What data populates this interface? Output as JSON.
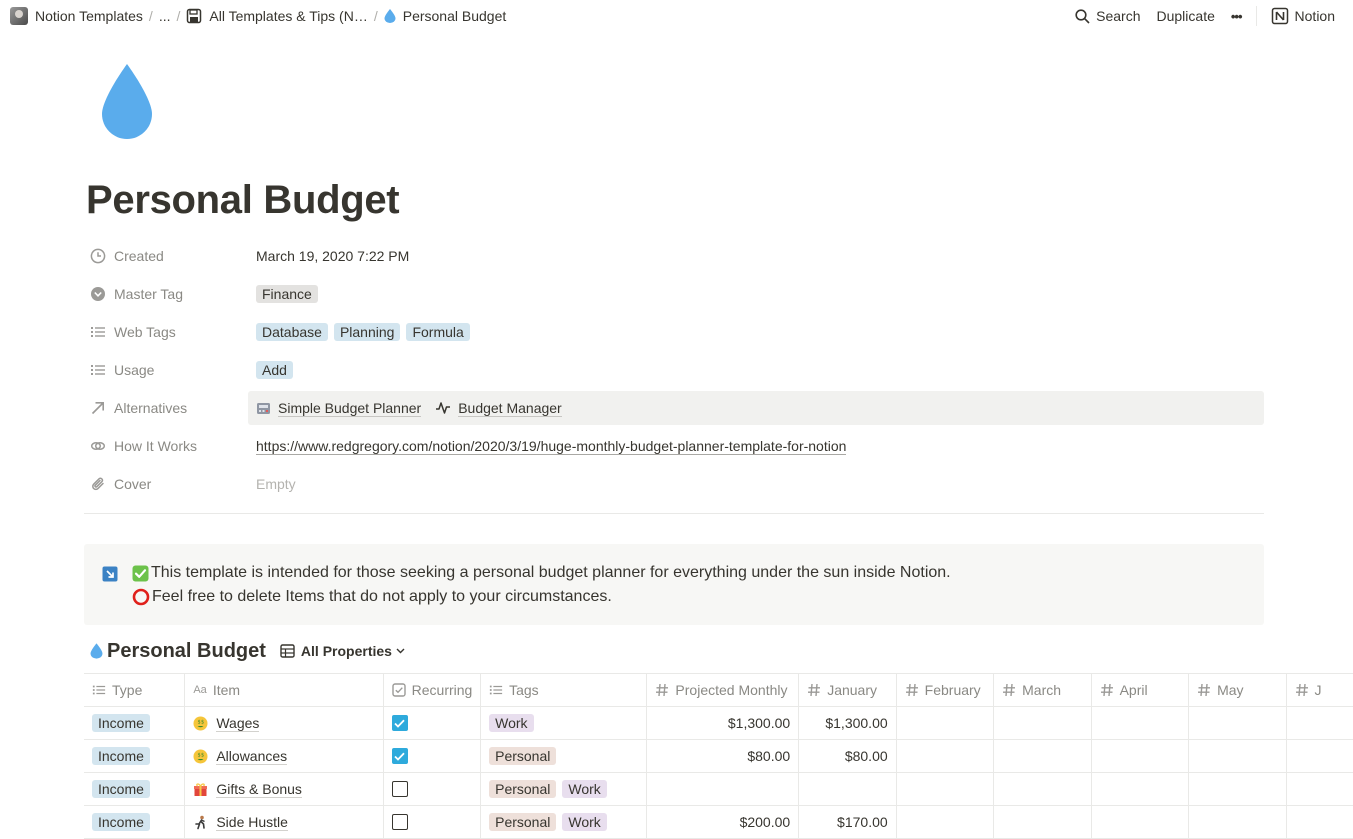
{
  "breadcrumb": {
    "workspace": "Notion Templates",
    "ellipsis": "...",
    "section": "All Templates & Tips (N…",
    "current": "Personal Budget",
    "separator": "/"
  },
  "top_actions": {
    "search": "Search",
    "duplicate": "Duplicate",
    "more": "•••",
    "notion": "Notion"
  },
  "page": {
    "title": "Personal Budget",
    "icon": "droplet-icon"
  },
  "properties": {
    "created": {
      "label": "Created",
      "value": "March 19, 2020 7:22 PM"
    },
    "master_tag": {
      "label": "Master Tag",
      "tags": [
        "Finance"
      ]
    },
    "web_tags": {
      "label": "Web Tags",
      "tags": [
        "Database",
        "Planning",
        "Formula"
      ]
    },
    "usage": {
      "label": "Usage",
      "tags": [
        "Add"
      ]
    },
    "alternatives": {
      "label": "Alternatives",
      "items": [
        "Simple Budget Planner",
        "Budget Manager"
      ]
    },
    "how_it_works": {
      "label": "How It Works",
      "value": "https://www.redgregory.com/notion/2020/3/19/huge-monthly-budget-planner-template-for-notion"
    },
    "cover": {
      "label": "Cover",
      "value": "Empty"
    }
  },
  "callout": {
    "line1": "This template is intended for those seeking a personal budget planner for everything under the sun inside Notion.",
    "line2": "Feel free to delete Items that do not apply to your circumstances."
  },
  "database": {
    "title": "Personal Budget",
    "view": "All Properties",
    "columns": [
      "Type",
      "Item",
      "Recurring",
      "Tags",
      "Projected Monthly",
      "January",
      "February",
      "March",
      "April",
      "May",
      "J"
    ],
    "rows": [
      {
        "type": "Income",
        "item": "Wages",
        "icon": "money-face-icon",
        "recurring": true,
        "tags": [
          "Work"
        ],
        "projected": "$1,300.00",
        "january": "$1,300.00"
      },
      {
        "type": "Income",
        "item": "Allowances",
        "icon": "money-face-icon",
        "recurring": true,
        "tags": [
          "Personal"
        ],
        "projected": "$80.00",
        "january": "$80.00"
      },
      {
        "type": "Income",
        "item": "Gifts & Bonus",
        "icon": "gift-icon",
        "recurring": false,
        "tags": [
          "Personal",
          "Work"
        ],
        "projected": "",
        "january": ""
      },
      {
        "type": "Income",
        "item": "Side Hustle",
        "icon": "person-running-icon",
        "recurring": false,
        "tags": [
          "Personal",
          "Work"
        ],
        "projected": "$200.00",
        "january": "$170.00"
      }
    ]
  },
  "colors": {
    "text": "#37352f",
    "muted": "#8a8984",
    "accent_checkbox": "#2eaadc",
    "droplet": "#5aacec",
    "tag_gray": "#e3e2e0",
    "tag_blue": "#d3e5ef",
    "tag_brown": "#eee0da",
    "tag_purple": "#e8deee"
  }
}
